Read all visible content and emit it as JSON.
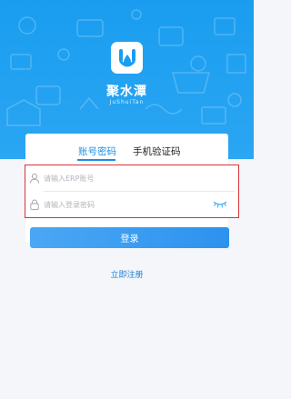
{
  "brand": {
    "name": "聚水潭",
    "subtitle": "JuShuiTan",
    "logo_icon": "water-drop-icon",
    "primary_color": "#1a9df0"
  },
  "tabs": [
    {
      "label": "账号密码",
      "active": true
    },
    {
      "label": "手机验证码",
      "active": false
    }
  ],
  "form": {
    "account_placeholder": "请输入ERP账号",
    "account_value": "",
    "account_icon": "user-icon",
    "password_placeholder": "请输入登录密码",
    "password_value": "",
    "password_icon": "lock-icon",
    "toggle_icon": "eye-closed-icon",
    "highlight_color": "#d9343a"
  },
  "login_button": {
    "label": "登录"
  },
  "register_link": {
    "label": "立即注册"
  }
}
